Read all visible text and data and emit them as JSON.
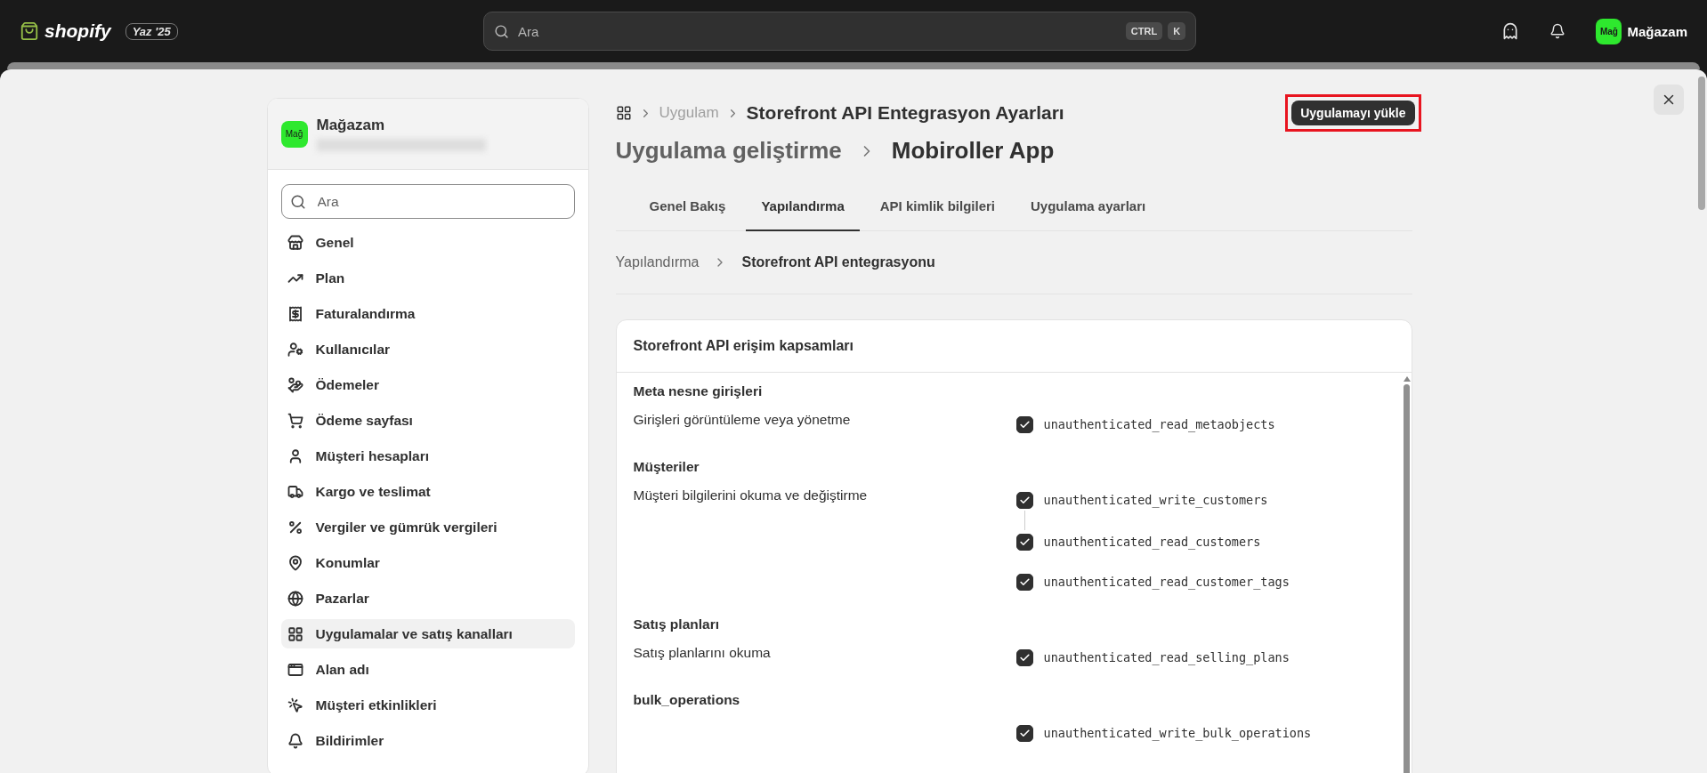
{
  "topbar": {
    "logo": "shopify",
    "badge": "Yaz '25",
    "search": {
      "placeholder": "Ara"
    },
    "shortcut": [
      "CTRL",
      "K"
    ],
    "store": {
      "avatar": "Mağ",
      "name": "Mağazam"
    }
  },
  "sidebar": {
    "store": {
      "avatar": "Mağ",
      "name": "Mağazam"
    },
    "search": {
      "placeholder": "Ara"
    },
    "items": [
      {
        "label": "Genel",
        "selected": false
      },
      {
        "label": "Plan",
        "selected": false
      },
      {
        "label": "Faturalandırma",
        "selected": false
      },
      {
        "label": "Kullanıcılar",
        "selected": false
      },
      {
        "label": "Ödemeler",
        "selected": false
      },
      {
        "label": "Ödeme sayfası",
        "selected": false
      },
      {
        "label": "Müşteri hesapları",
        "selected": false
      },
      {
        "label": "Kargo ve teslimat",
        "selected": false
      },
      {
        "label": "Vergiler ve gümrük vergileri",
        "selected": false
      },
      {
        "label": "Konumlar",
        "selected": false
      },
      {
        "label": "Pazarlar",
        "selected": false
      },
      {
        "label": "Uygulamalar ve satış kanalları",
        "selected": true
      },
      {
        "label": "Alan adı",
        "selected": false
      },
      {
        "label": "Müşteri etkinlikleri",
        "selected": false
      },
      {
        "label": "Bildirimler",
        "selected": false
      }
    ]
  },
  "breadcrumb": [
    "Uygulam",
    "Storefront API Entegrasyon Ayarları"
  ],
  "install_button": {
    "label": "Uygulamayı yükle",
    "highlighted": true
  },
  "title": [
    "Uygulama geliştirme",
    "Mobiroller App"
  ],
  "tabs": [
    {
      "label": "Genel Bakış",
      "selected": false
    },
    {
      "label": "Yapılandırma",
      "selected": true
    },
    {
      "label": "API kimlik bilgileri",
      "selected": false
    },
    {
      "label": "Uygulama ayarları",
      "selected": false
    }
  ],
  "sub_breadcrumb": [
    "Yapılandırma",
    "Storefront API entegrasyonu"
  ],
  "card": {
    "title": "Storefront API erişim kapsamları",
    "sections": [
      {
        "title": "Meta nesne girişleri",
        "description": "Girişleri görüntüleme veya yönetme",
        "scopes": [
          {
            "name": "unauthenticated_read_metaobjects",
            "checked": true
          }
        ]
      },
      {
        "title": "Müşteriler",
        "description": "Müşteri bilgilerini okuma ve değiştirme",
        "scopes": [
          {
            "name": "unauthenticated_write_customers",
            "checked": true,
            "children": [
              {
                "name": "unauthenticated_read_customers",
                "checked": true
              }
            ]
          },
          {
            "name": "unauthenticated_read_customer_tags",
            "checked": true
          }
        ]
      },
      {
        "title": "Satış planları",
        "description": "Satış planlarını okuma",
        "scopes": [
          {
            "name": "unauthenticated_read_selling_plans",
            "checked": true
          }
        ]
      },
      {
        "title": "bulk_operations",
        "scopes": [
          {
            "name": "unauthenticated_write_bulk_operations",
            "checked": true
          }
        ]
      }
    ]
  }
}
